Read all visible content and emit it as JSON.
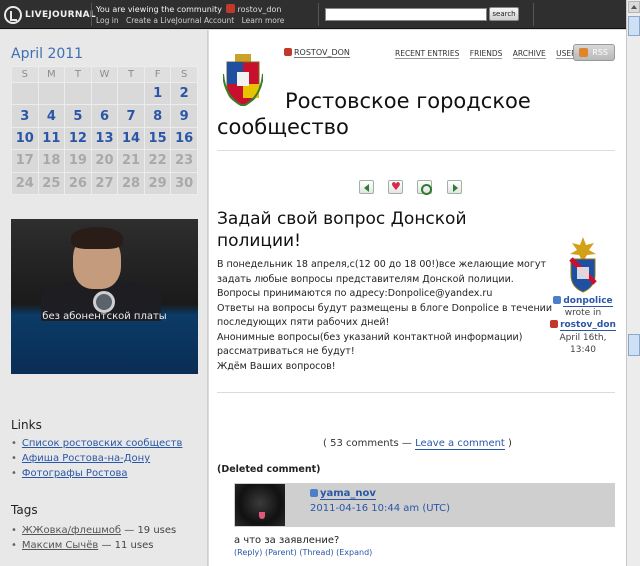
{
  "topbar": {
    "logo": "LIVEJOURNAL",
    "viewing_text": "You are viewing the community",
    "community": "rostov_don",
    "links": [
      "Log in",
      "Create a LiveJournal Account",
      "Learn more"
    ],
    "search_value": "",
    "search_button": "search"
  },
  "calendar": {
    "title": "April 2011",
    "weekdays": [
      "S",
      "M",
      "T",
      "W",
      "T",
      "F",
      "S"
    ],
    "weeks": [
      [
        "",
        "",
        "",
        "",
        "",
        "1",
        "2"
      ],
      [
        "3",
        "4",
        "5",
        "6",
        "7",
        "8",
        "9"
      ],
      [
        "10",
        "11",
        "12",
        "13",
        "14",
        "15",
        "16"
      ],
      [
        "17",
        "18",
        "19",
        "20",
        "21",
        "22",
        "23"
      ],
      [
        "24",
        "25",
        "26",
        "27",
        "28",
        "29",
        "30"
      ]
    ]
  },
  "ad": {
    "text": "без абонентской платы"
  },
  "links_section": {
    "title": "Links",
    "items": [
      "Список ростовских сообществ",
      "Афиша Ростова-на-Дону",
      "Фотографы Ростова"
    ]
  },
  "tags_section": {
    "title": "Tags",
    "items": [
      {
        "name": "ЖЖовка/флешмоб",
        "count": "— 19 uses"
      },
      {
        "name": "Максим Сычёв",
        "count": "— 11 uses"
      }
    ]
  },
  "header": {
    "community_user": "ROSTOV_DON",
    "nav": [
      "RECENT ENTRIES",
      "FRIENDS",
      "ARCHIVE",
      "USER INFO"
    ],
    "rss": "RSS",
    "title_line1": "Ростовское городское",
    "title_line2": "сообщество"
  },
  "post": {
    "title": "Задай свой вопрос Донской полиции!",
    "body_lines": [
      "В понедельник 18 апреля,с(12 00 до 18 00!)все желающие могут",
      "задать любые вопросы представителям Донской полиции.",
      "Вопросы принимаются по адресу:Donpolice@yandex.ru",
      "Ответы на вопросы будут размещены в блоге Donpolice в течении",
      "последующих пяти рабочих дней!",
      "Анонимные вопросы(без указаний контактной информации)",
      "рассматриваться не будут!",
      "Ждём Ваших вопросов!"
    ],
    "author": "donpolice",
    "wrote_in": "wrote in",
    "community": "rostov_don",
    "date": "April 16th, 13:40"
  },
  "comments": {
    "count_text": "( 53 comments —",
    "leave_link": "Leave a comment",
    "close_paren": ")",
    "deleted": "(Deleted comment)",
    "items": [
      {
        "user": "yama_nov",
        "date": "2011-04-16 10:44 am (UTC)",
        "text": "а что за заявление?",
        "actions": [
          "(Reply)",
          "(Parent)",
          "(Thread)",
          "(Expand)"
        ]
      }
    ]
  },
  "colors": {
    "link": "#2a56a8",
    "topbar": "#2f2f2f",
    "sidebar": "#e8e8e8",
    "rss_accent": "#e0852c"
  }
}
